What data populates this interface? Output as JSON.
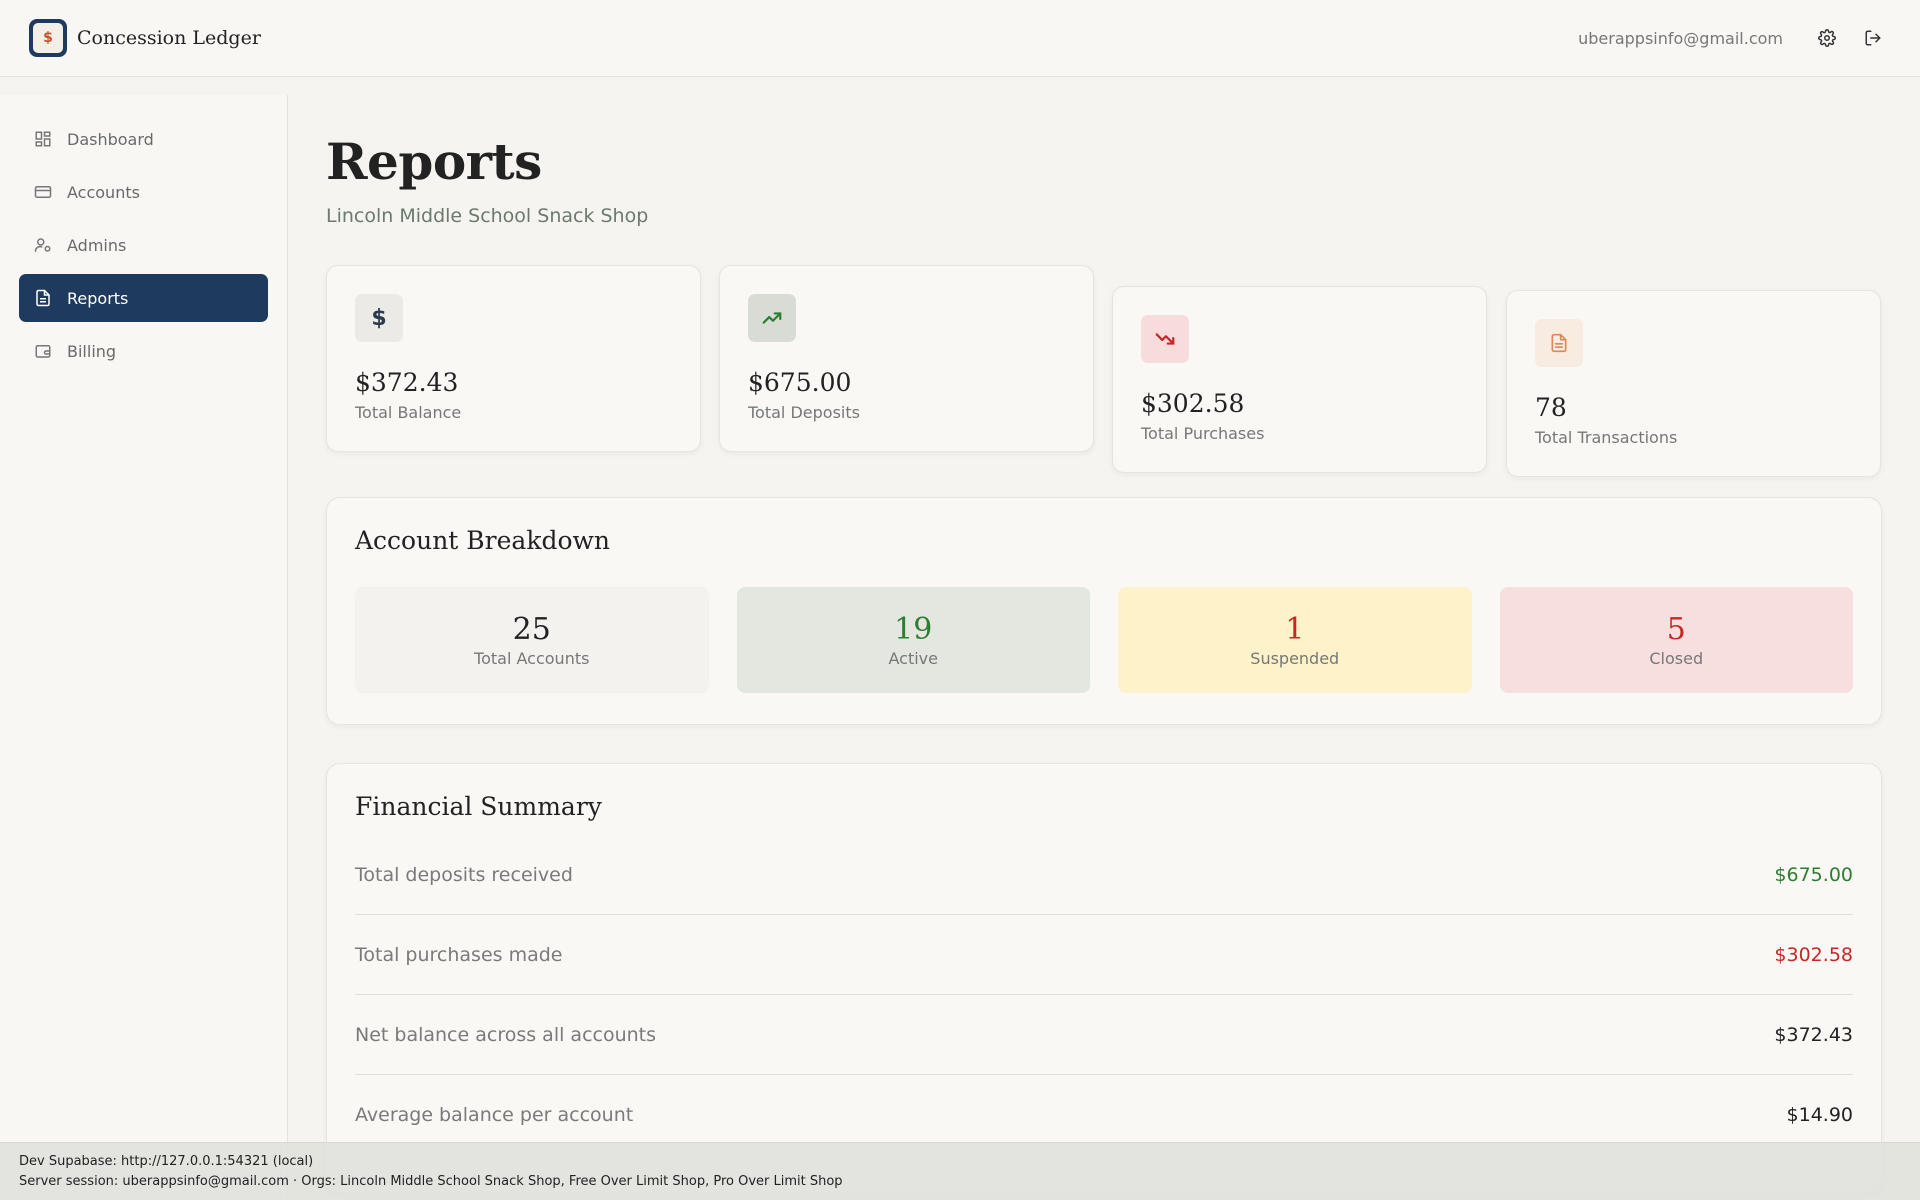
{
  "app": {
    "brand": "Concession Ledger",
    "user_email": "uberappsinfo@gmail.com"
  },
  "sidebar": {
    "items": [
      {
        "label": "Dashboard",
        "icon": "dashboard-grid-icon",
        "active": false
      },
      {
        "label": "Accounts",
        "icon": "credit-card-icon",
        "active": false
      },
      {
        "label": "Admins",
        "icon": "user-gear-icon",
        "active": false
      },
      {
        "label": "Reports",
        "icon": "document-icon",
        "active": true
      },
      {
        "label": "Billing",
        "icon": "wallet-icon",
        "active": false
      }
    ]
  },
  "page": {
    "title": "Reports",
    "subtitle": "Lincoln Middle School Snack Shop"
  },
  "stats": [
    {
      "value": "$372.43",
      "label": "Total Balance",
      "icon": "dollar-icon",
      "color": "#2b3a4e",
      "bg": "#ebeae6"
    },
    {
      "value": "$675.00",
      "label": "Total Deposits",
      "icon": "trending-up-icon",
      "color": "#2e7d32",
      "bg": "#d9dcd5"
    },
    {
      "value": "$302.58",
      "label": "Total Purchases",
      "icon": "trending-down-icon",
      "color": "#c62828",
      "bg": "#f8dcdc"
    },
    {
      "value": "78",
      "label": "Total Transactions",
      "icon": "file-text-icon",
      "color": "#d98a5a",
      "bg": "#f8ebe0"
    }
  ],
  "breakdown": {
    "title": "Account Breakdown",
    "items": [
      {
        "value": "25",
        "label": "Total Accounts",
        "color": "#222222",
        "bg": "#f3f2ee"
      },
      {
        "value": "19",
        "label": "Active",
        "color": "#2e7d32",
        "bg": "#e4e7e0"
      },
      {
        "value": "1",
        "label": "Suspended",
        "color": "#c62828",
        "bg": "#fdf2c9"
      },
      {
        "value": "5",
        "label": "Closed",
        "color": "#c62828",
        "bg": "#f7dfdf"
      }
    ]
  },
  "summary": {
    "title": "Financial Summary",
    "rows": [
      {
        "label": "Total deposits received",
        "value": "$675.00",
        "color": "#2e7d32"
      },
      {
        "label": "Total purchases made",
        "value": "$302.58",
        "color": "#c62828"
      },
      {
        "label": "Net balance across all accounts",
        "value": "$372.43",
        "color": "#222222"
      },
      {
        "label": "Average balance per account",
        "value": "$14.90",
        "color": "#222222"
      }
    ]
  },
  "devbar": {
    "line1": "Dev Supabase: http://127.0.0.1:54321 (local)",
    "line2": "Server session: uberappsinfo@gmail.com · Orgs: Lincoln Middle School Snack Shop, Free Over Limit Shop, Pro Over Limit Shop"
  }
}
